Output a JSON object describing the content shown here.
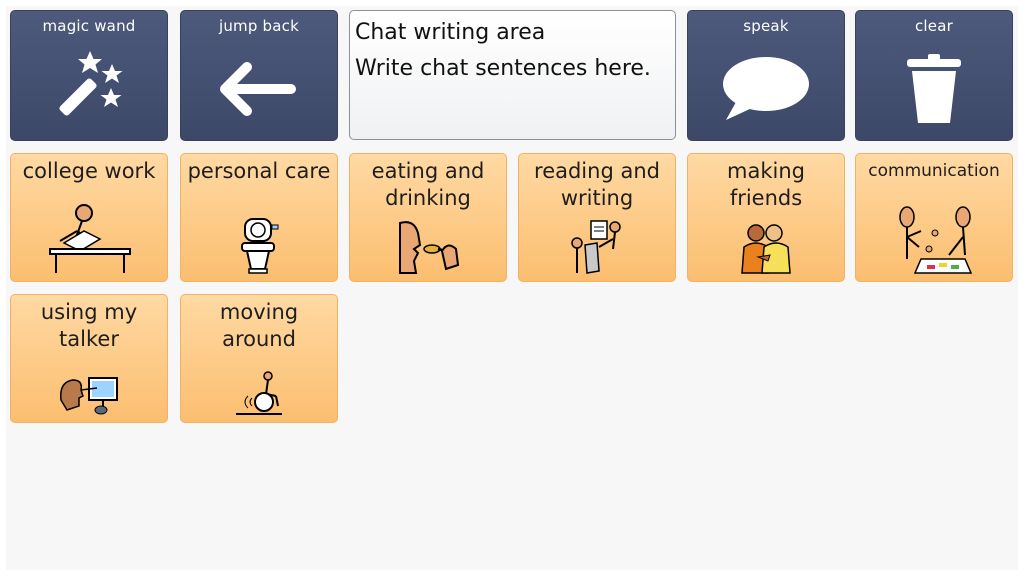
{
  "toolbar": {
    "magic_wand": "magic wand",
    "jump_back": "jump back",
    "speak": "speak",
    "clear": "clear"
  },
  "chat": {
    "title": "Chat writing area",
    "placeholder": "Write chat sentences here."
  },
  "categories": [
    {
      "label": "college work",
      "icon": "desk-study-icon"
    },
    {
      "label": "personal care",
      "icon": "toilet-icon"
    },
    {
      "label": "eating and drinking",
      "icon": "eating-icon"
    },
    {
      "label": "reading and writing",
      "icon": "reading-icon"
    },
    {
      "label": "making friends",
      "icon": "friends-icon"
    },
    {
      "label": "communication",
      "icon": "communication-board-icon"
    },
    {
      "label": "using my talker",
      "icon": "talker-device-icon"
    },
    {
      "label": "moving around",
      "icon": "wheelchair-icon"
    }
  ],
  "colors": {
    "toolbar_bg": "#46516f",
    "category_bg": "#fcc67e",
    "board_bg": "#f7f7f7"
  }
}
